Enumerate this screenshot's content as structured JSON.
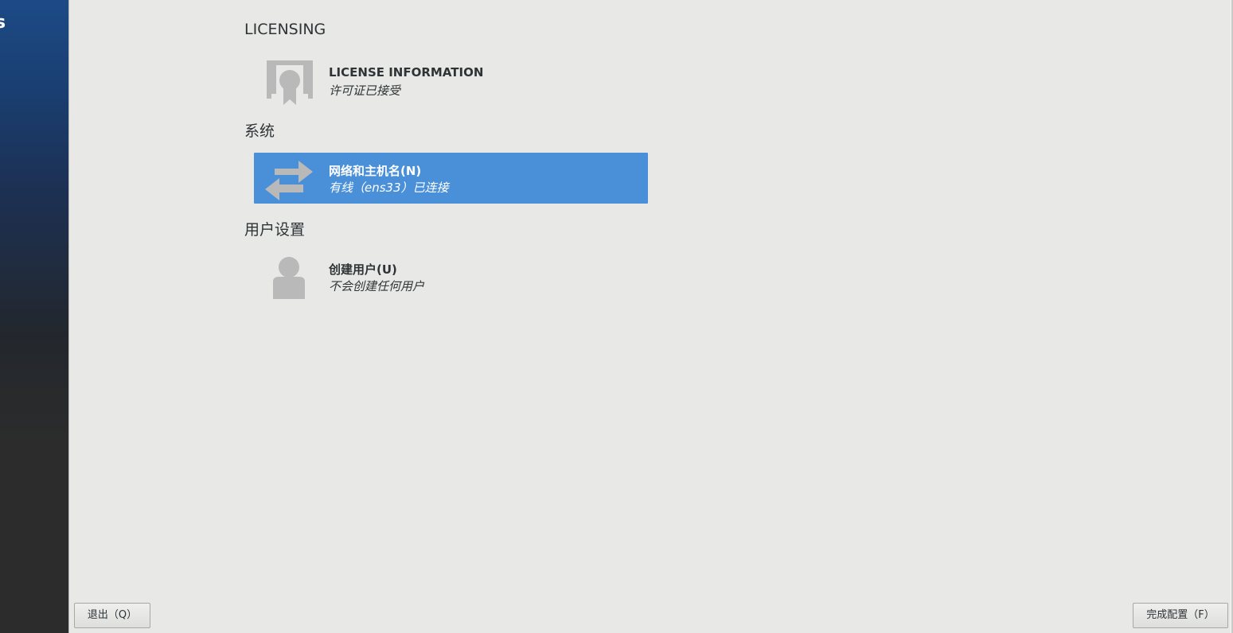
{
  "sidebar": {
    "brand_fragment": "s"
  },
  "licensing": {
    "title": "LICENSING",
    "license_info": {
      "title": "LICENSE INFORMATION",
      "status": "许可证已接受",
      "icon": "license-certificate-icon"
    }
  },
  "system": {
    "title": "系统",
    "network": {
      "title": "网络和主机名(N)",
      "status": "有线（ens33）已连接",
      "icon": "network-transfer-arrows-icon",
      "selected": true
    }
  },
  "user_settings": {
    "title": "用户设置",
    "create_user": {
      "title": "创建用户(U)",
      "status": "不会创建任何用户",
      "icon": "user-avatar-icon"
    }
  },
  "footer": {
    "quit_label": "退出（Q）",
    "finish_label": "完成配置（F）"
  },
  "colors": {
    "background": "#e8e8e7",
    "selected_spoke": "#4a90d9",
    "icon_gray": "#b9b9b9",
    "text": "#2e3436"
  }
}
